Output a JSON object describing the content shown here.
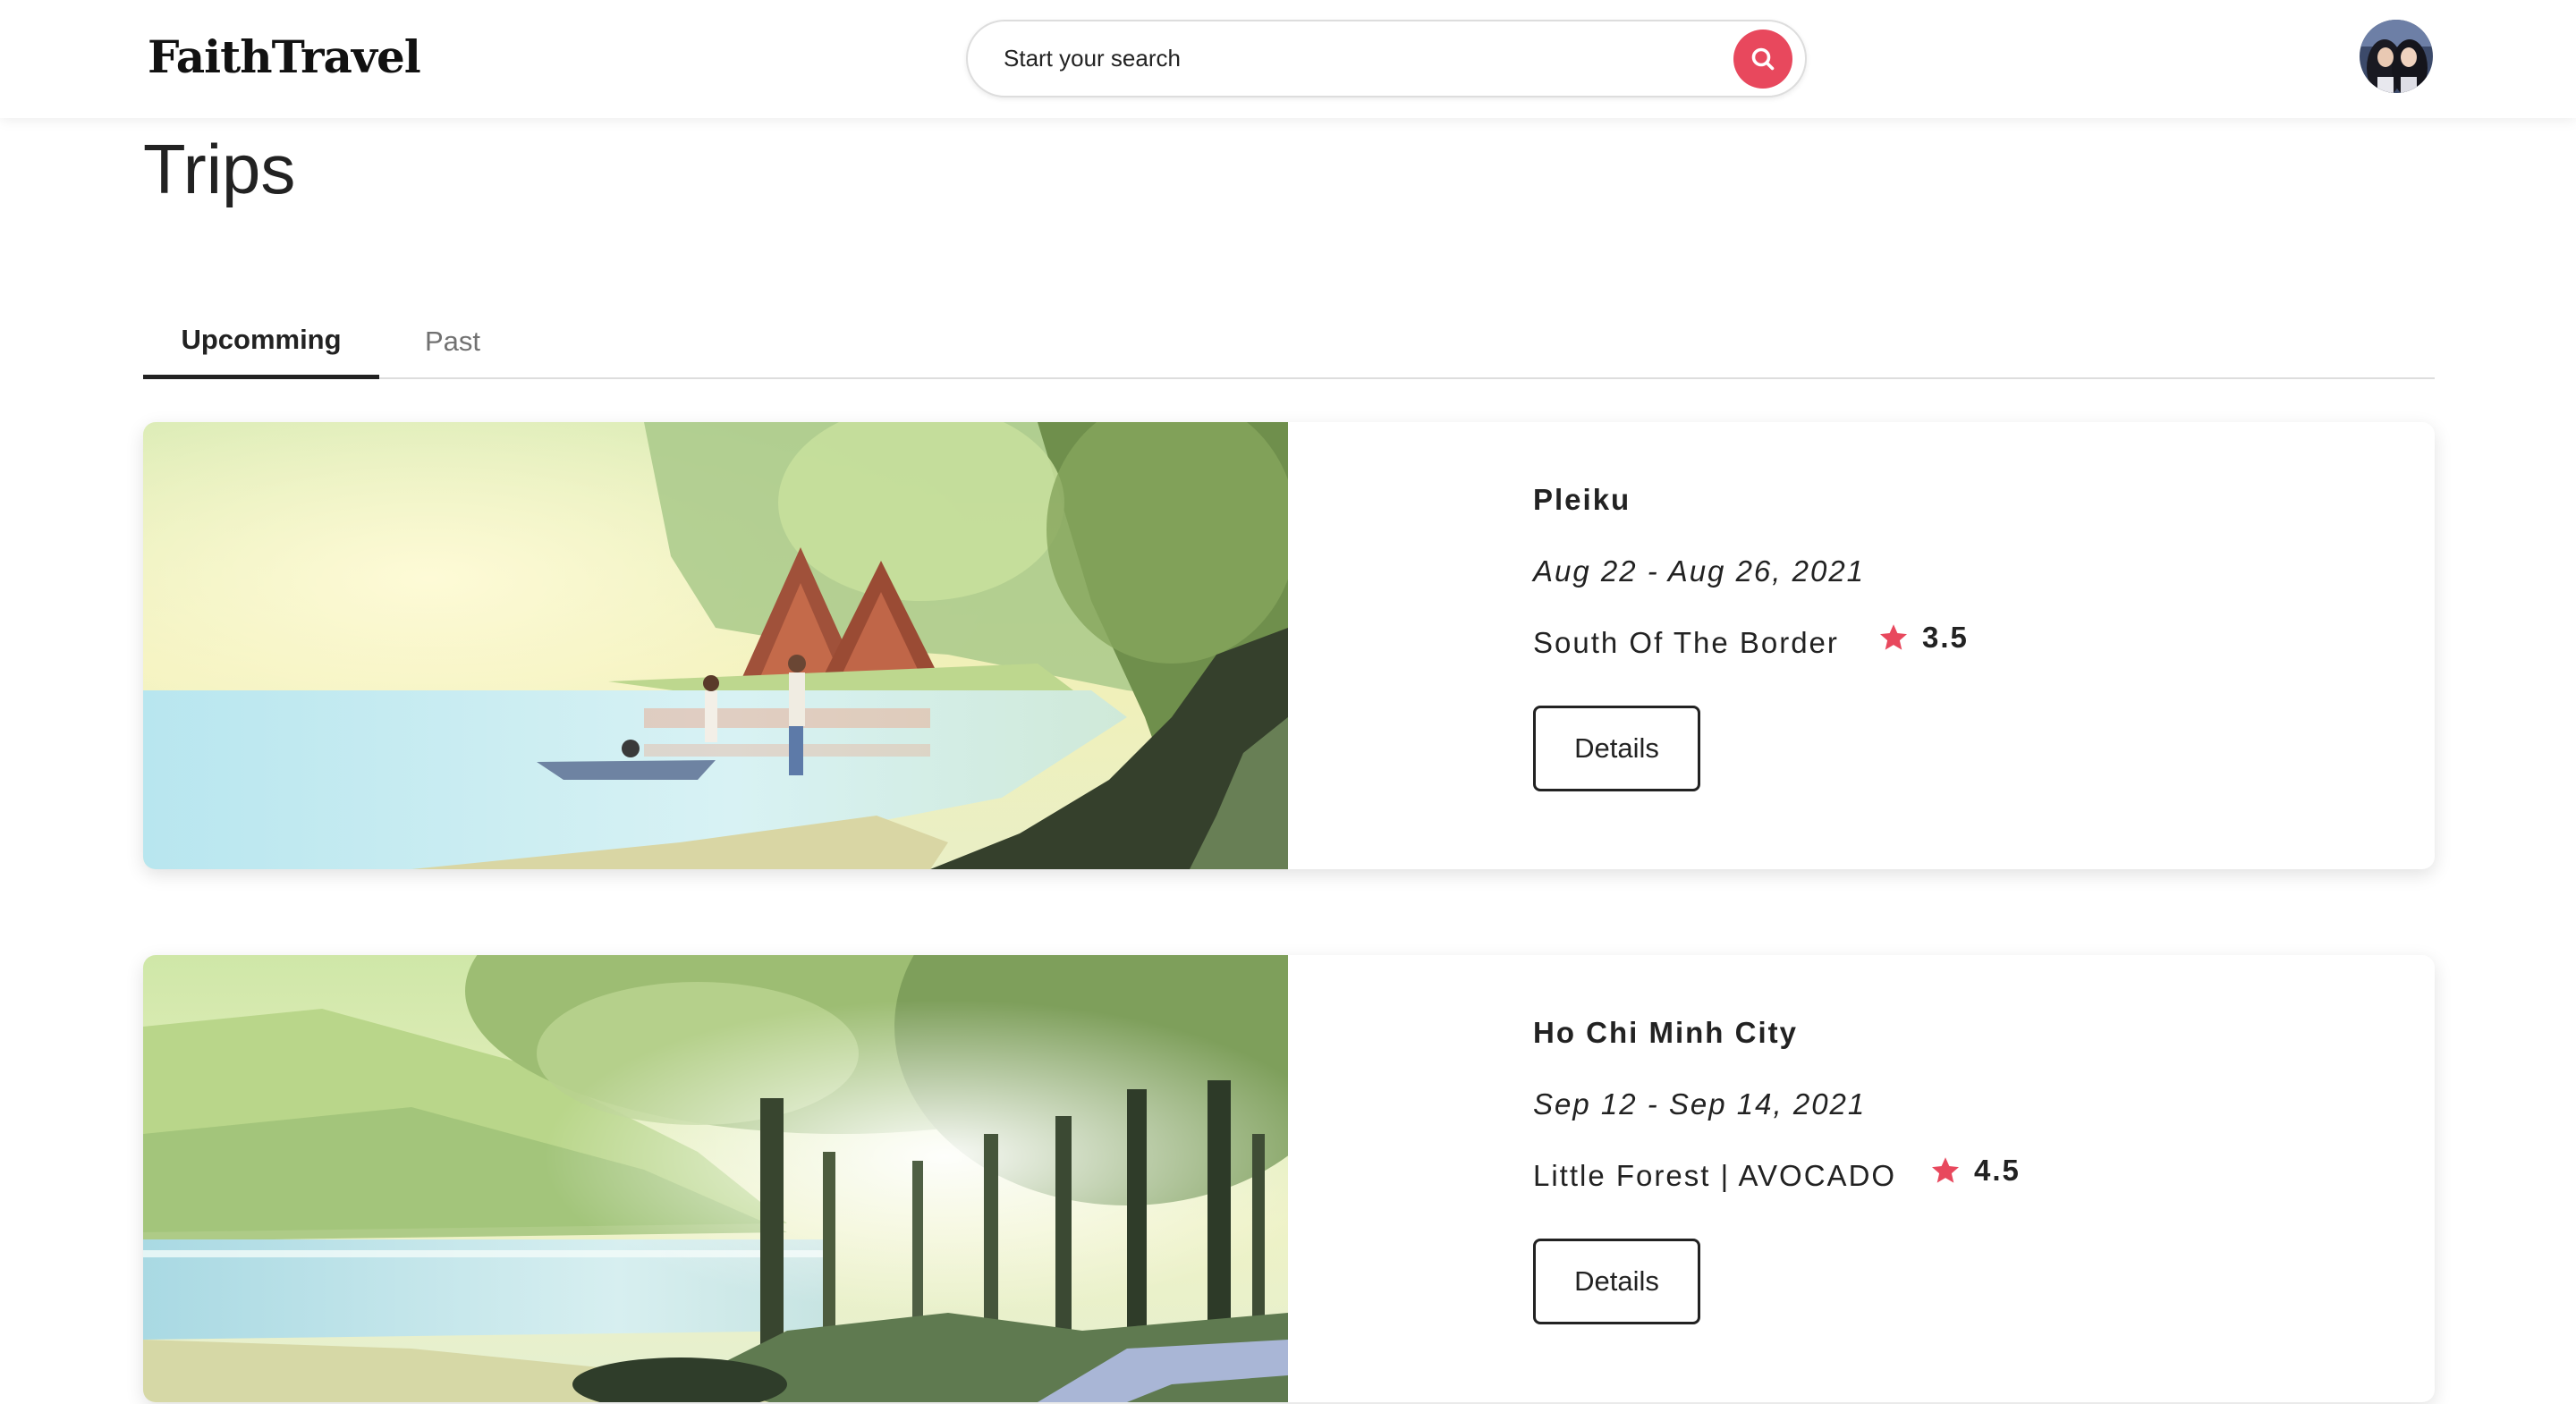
{
  "header": {
    "logo": "FaithTravel",
    "search": {
      "placeholder": "Start your search"
    }
  },
  "page": {
    "title": "Trips"
  },
  "tabs": [
    {
      "label": "Upcomming",
      "active": true
    },
    {
      "label": "Past",
      "active": false
    }
  ],
  "trips": [
    {
      "title": "Pleiku",
      "dates": "Aug 22 - Aug 26, 2021",
      "place": "South Of The Border",
      "rating": "3.5",
      "details_label": "Details"
    },
    {
      "title": "Ho Chi Minh City",
      "dates": "Sep 12 - Sep 14, 2021",
      "place": "Little Forest | AVOCADO",
      "rating": "4.5",
      "details_label": "Details"
    }
  ],
  "colors": {
    "accent": "#e8485d",
    "text": "#222222",
    "muted": "#717171"
  }
}
